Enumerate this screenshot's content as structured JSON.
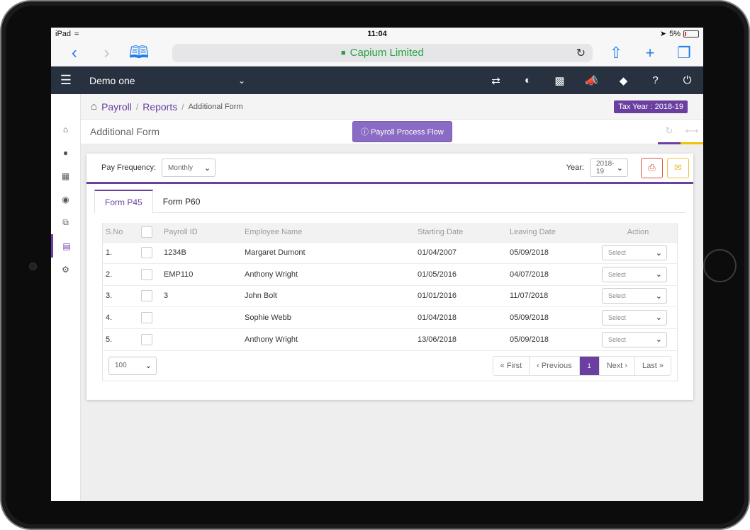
{
  "status": {
    "device": "iPad",
    "time": "11:04",
    "battery": "5%"
  },
  "browser": {
    "url_title": "Capium Limited"
  },
  "header": {
    "company": "Demo one",
    "icons": [
      "exchange-icon",
      "palette-icon",
      "cubes-icon",
      "bullhorn-icon",
      "ticket-icon",
      "help-icon",
      "power-icon"
    ]
  },
  "sidebar": {
    "items": [
      "home-icon",
      "user-icon",
      "grid-icon",
      "users-icon",
      "copy-icon",
      "report-icon",
      "settings-icon"
    ],
    "active_index": 5
  },
  "breadcrumb": {
    "items": [
      "Payroll",
      "Reports"
    ],
    "current": "Additional Form"
  },
  "tax_year": "Tax Year : 2018-19",
  "page": {
    "title": "Additional Form",
    "flow_button": "Payroll Process Flow"
  },
  "filters": {
    "frequency_label": "Pay Frequency:",
    "frequency_value": "Monthly",
    "year_label": "Year:",
    "year_value": "2018-19"
  },
  "tabs": [
    "Form P45",
    "Form P60"
  ],
  "table": {
    "headers": [
      "S.No",
      "Payroll ID",
      "Employee Name",
      "Starting Date",
      "Leaving Date",
      "Action"
    ],
    "rows": [
      {
        "sno": "1.",
        "payroll_id": "1234B",
        "name": "Margaret Dumont",
        "start": "01/04/2007",
        "leave": "05/09/2018",
        "action": "Select"
      },
      {
        "sno": "2.",
        "payroll_id": "EMP110",
        "name": "Anthony Wright",
        "start": "01/05/2016",
        "leave": "04/07/2018",
        "action": "Select"
      },
      {
        "sno": "3.",
        "payroll_id": "3",
        "name": "John Bolt",
        "start": "01/01/2016",
        "leave": "11/07/2018",
        "action": "Select"
      },
      {
        "sno": "4.",
        "payroll_id": "",
        "name": "Sophie Webb",
        "start": "01/04/2018",
        "leave": "05/09/2018",
        "action": "Select"
      },
      {
        "sno": "5.",
        "payroll_id": "",
        "name": "Anthony Wright",
        "start": "13/06/2018",
        "leave": "05/09/2018",
        "action": "Select"
      }
    ]
  },
  "pagination": {
    "page_size": "100",
    "first": "« First",
    "previous": "‹ Previous",
    "current": "1",
    "next": "Next ›",
    "last": "Last »"
  },
  "colors": {
    "brand": "#6a3fa0",
    "header": "#27313f",
    "accent_yellow": "#f2c200"
  }
}
